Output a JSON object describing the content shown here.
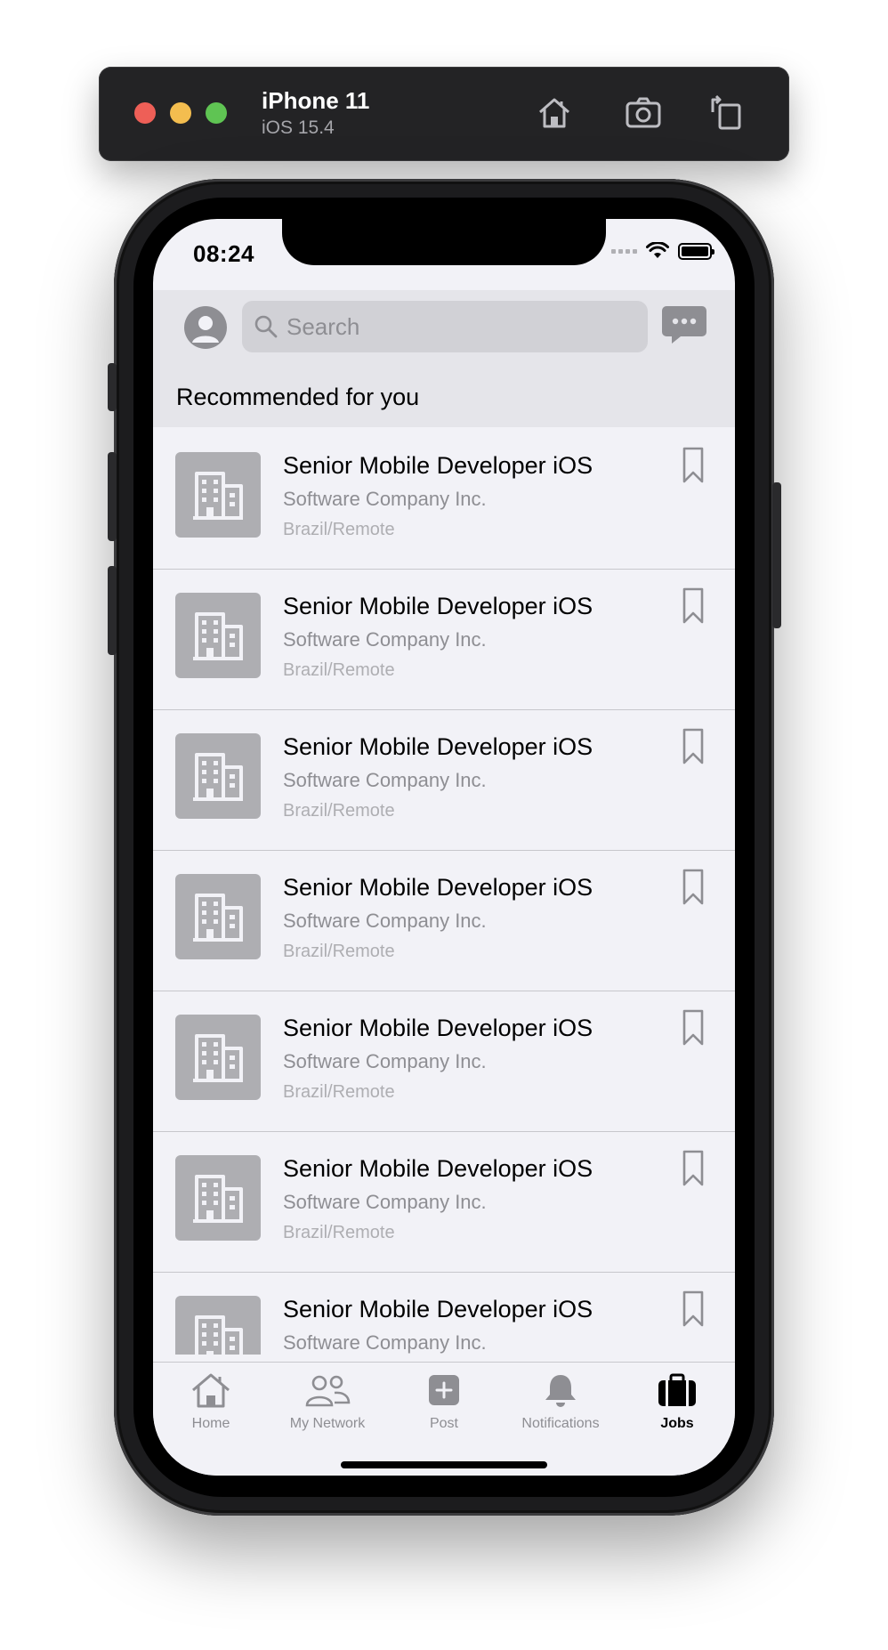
{
  "simulator": {
    "device_name": "iPhone 11",
    "os_version": "iOS 15.4",
    "toolbar": [
      "home-icon",
      "screenshot-icon",
      "rotate-icon"
    ]
  },
  "status_bar": {
    "time": "08:24"
  },
  "header": {
    "search_placeholder": "Search"
  },
  "section": {
    "title": "Recommended for you"
  },
  "jobs": [
    {
      "title": "Senior Mobile Developer iOS",
      "company": "Software Company Inc.",
      "location": "Brazil/Remote"
    },
    {
      "title": "Senior Mobile Developer iOS",
      "company": "Software Company Inc.",
      "location": "Brazil/Remote"
    },
    {
      "title": "Senior Mobile Developer iOS",
      "company": "Software Company Inc.",
      "location": "Brazil/Remote"
    },
    {
      "title": "Senior Mobile Developer iOS",
      "company": "Software Company Inc.",
      "location": "Brazil/Remote"
    },
    {
      "title": "Senior Mobile Developer iOS",
      "company": "Software Company Inc.",
      "location": "Brazil/Remote"
    },
    {
      "title": "Senior Mobile Developer iOS",
      "company": "Software Company Inc.",
      "location": "Brazil/Remote"
    },
    {
      "title": "Senior Mobile Developer iOS",
      "company": "Software Company Inc.",
      "location": ""
    }
  ],
  "tabs": [
    {
      "label": "Home",
      "icon": "house-icon",
      "active": false
    },
    {
      "label": "My Network",
      "icon": "people-icon",
      "active": false
    },
    {
      "label": "Post",
      "icon": "plus-square-icon",
      "active": false
    },
    {
      "label": "Notifications",
      "icon": "bell-icon",
      "active": false
    },
    {
      "label": "Jobs",
      "icon": "briefcase-icon",
      "active": true
    }
  ],
  "colors": {
    "screen_bg": "#f2f2f7",
    "header_bg": "#e5e5ea",
    "secondary_text": "#8e8e93",
    "placeholder_gray": "#aeaeb2"
  }
}
